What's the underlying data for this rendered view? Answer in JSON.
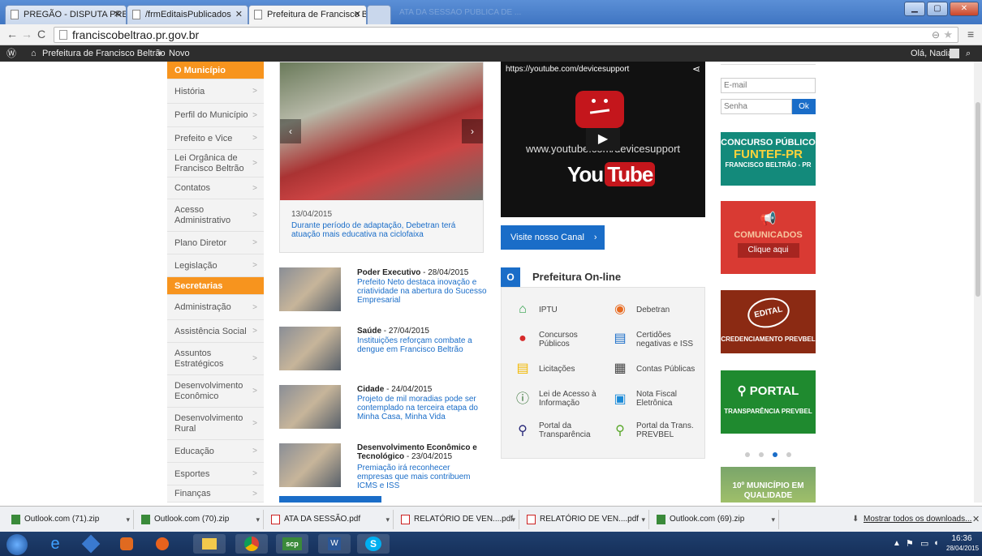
{
  "browser": {
    "tabs": [
      {
        "label": "PREGÃO - DISPUTA PREG"
      },
      {
        "label": "/frmEditaisPublicados"
      },
      {
        "label": "Prefeitura de Francisco Be"
      },
      {
        "label": "ATA DA SESSÃO PÚBLICA DE ..."
      }
    ],
    "url": "franciscobeltrao.pr.gov.br"
  },
  "admin_bar": {
    "site_name": "Prefeitura de Francisco Beltrão",
    "new_label": "Novo",
    "greeting": "Olá, Nadia"
  },
  "sidebar": {
    "municipio_header": "O Município",
    "municipio_items": [
      {
        "label": "História"
      },
      {
        "label": "Perfil do Município"
      },
      {
        "label": "Prefeito e Vice"
      },
      {
        "label": "Lei Orgânica de Francisco Beltrão"
      },
      {
        "label": "Contatos"
      },
      {
        "label": "Acesso Administrativo"
      },
      {
        "label": "Plano Diretor"
      },
      {
        "label": "Legislação"
      }
    ],
    "secretarias_header": "Secretarias",
    "secretarias_items": [
      {
        "label": "Administração"
      },
      {
        "label": "Assistência Social"
      },
      {
        "label": "Assuntos Estratégicos"
      },
      {
        "label": "Desenvolvimento Econômico"
      },
      {
        "label": "Desenvolvimento Rural"
      },
      {
        "label": "Educação"
      },
      {
        "label": "Esportes"
      },
      {
        "label": "Finanças"
      }
    ]
  },
  "featured": {
    "date": "13/04/2015",
    "title": "Durante período de adaptação, Debetran terá atuação mais educativa na ciclofaixa"
  },
  "news": [
    {
      "category": "Poder Executivo",
      "date": " - 28/04/2015",
      "title": "Prefeito Neto destaca inovação e criatividade na abertura do Sucesso Empresarial"
    },
    {
      "category": "Saúde",
      "date": " - 27/04/2015",
      "title": "Instituições reforçam combate a dengue em Francisco Beltrão"
    },
    {
      "category": "Cidade",
      "date": " - 24/04/2015",
      "title": "Projeto de mil moradias pode ser contemplado na terceira etapa do Minha Casa, Minha Vida"
    },
    {
      "category": "Desenvolvimento Econômico e Tecnológico",
      "date": " - 23/04/2015",
      "title": "Premiação irá reconhecer empresas que mais contribuem ICMS e ISS"
    }
  ],
  "video": {
    "url_text": "https://youtube.com/devicesupport",
    "center_text": "www.youtube.com/devicesupport",
    "you": "You",
    "tube": "Tube"
  },
  "channel_button": "Visite nosso Canal",
  "online": {
    "badge": "O",
    "title": "Prefeitura On-line",
    "services": [
      {
        "label": "IPTU",
        "icon": "home-icon"
      },
      {
        "label": "Debetran",
        "icon": "car-icon"
      },
      {
        "label": "Concursos Públicos",
        "icon": "person-icon"
      },
      {
        "label": "Certidões negativas e ISS",
        "icon": "document-icon"
      },
      {
        "label": "Licitações",
        "icon": "list-icon"
      },
      {
        "label": "Contas Públicas",
        "icon": "calculator-icon"
      },
      {
        "label": "Lei de Acesso à Informação",
        "icon": "info-icon"
      },
      {
        "label": "Nota Fiscal Eletrônica",
        "icon": "invoice-icon"
      },
      {
        "label": "Portal da Transparência",
        "icon": "magnifier-icon"
      },
      {
        "label": "Portal da Trans. PREVBEL",
        "icon": "magnifier-leaf-icon"
      }
    ]
  },
  "login": {
    "email_placeholder": "E-mail",
    "password_placeholder": "Senha",
    "ok_label": "Ok"
  },
  "banners": {
    "concurso_line1": "CONCURSO PÚBLICO",
    "concurso_line2": "FUNTEF-PR",
    "concurso_line3": "FRANCISCO BELTRÃO - PR",
    "comunicados_title": "COMUNICADOS",
    "comunicados_button": "Clique aqui",
    "edital_badge": "EDITAL",
    "edital_caption": "CREDENCIAMENTO PREVBEL",
    "portal_title": "PORTAL",
    "portal_caption": "TRANSPARÊNCIA PREVBEL",
    "agencia_text": "10º MUNICÍPIO EM QUALIDADE"
  },
  "downloads": {
    "items": [
      {
        "label": "Outlook.com (71).zip"
      },
      {
        "label": "Outlook.com (70).zip"
      },
      {
        "label": "ATA DA SESSÃO.pdf"
      },
      {
        "label": "RELATÓRIO DE VEN....pdf"
      },
      {
        "label": "RELATÓRIO DE VEN....pdf"
      },
      {
        "label": "Outlook.com (69).zip"
      }
    ],
    "show_all": "Mostrar todos os downloads..."
  },
  "taskbar": {
    "time": "16:36",
    "date": "28/04/2015"
  },
  "colors": {
    "orange": "#f7941e",
    "blue_button": "#1a6dc8",
    "teal_banner": "#138a7b",
    "red_banner": "#d93a33",
    "brown_banner": "#8b2a13",
    "green_banner": "#1f8a2f"
  }
}
